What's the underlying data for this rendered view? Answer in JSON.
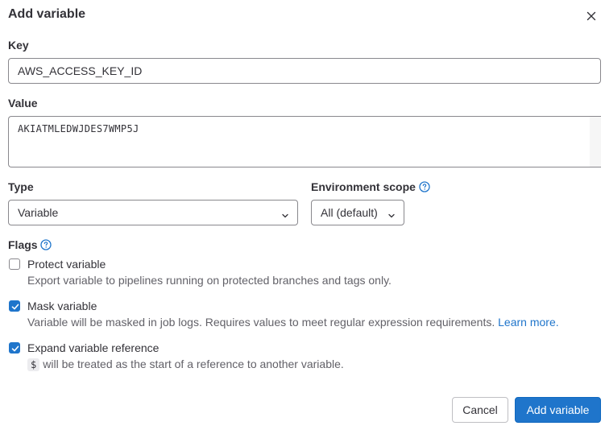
{
  "modal": {
    "title": "Add variable",
    "close_icon": "close-icon"
  },
  "key": {
    "label": "Key",
    "value": "AWS_ACCESS_KEY_ID"
  },
  "value_field": {
    "label": "Value",
    "value": "AKIATMLEDWJDES7WMP5J"
  },
  "type": {
    "label": "Type",
    "selected": "Variable",
    "icon": "chevron-down-icon"
  },
  "environment_scope": {
    "label": "Environment scope",
    "selected": "All (default)",
    "help_icon": "question-circle-icon"
  },
  "flags": {
    "label": "Flags",
    "help_icon": "question-circle-icon",
    "items": [
      {
        "label": "Protect variable",
        "checked": false,
        "help": "Export variable to pipelines running on protected branches and tags only."
      },
      {
        "label": "Mask variable",
        "checked": true,
        "help": "Variable will be masked in job logs. Requires values to meet regular expression requirements.",
        "link": "Learn more."
      },
      {
        "label": "Expand variable reference",
        "checked": true,
        "code": "$",
        "help": "will be treated as the start of a reference to another variable."
      }
    ]
  },
  "footer": {
    "cancel_label": "Cancel",
    "submit_label": "Add variable"
  },
  "colors": {
    "primary": "#1f75cb",
    "text": "#333238",
    "muted": "#626168",
    "border": "#89888d"
  }
}
